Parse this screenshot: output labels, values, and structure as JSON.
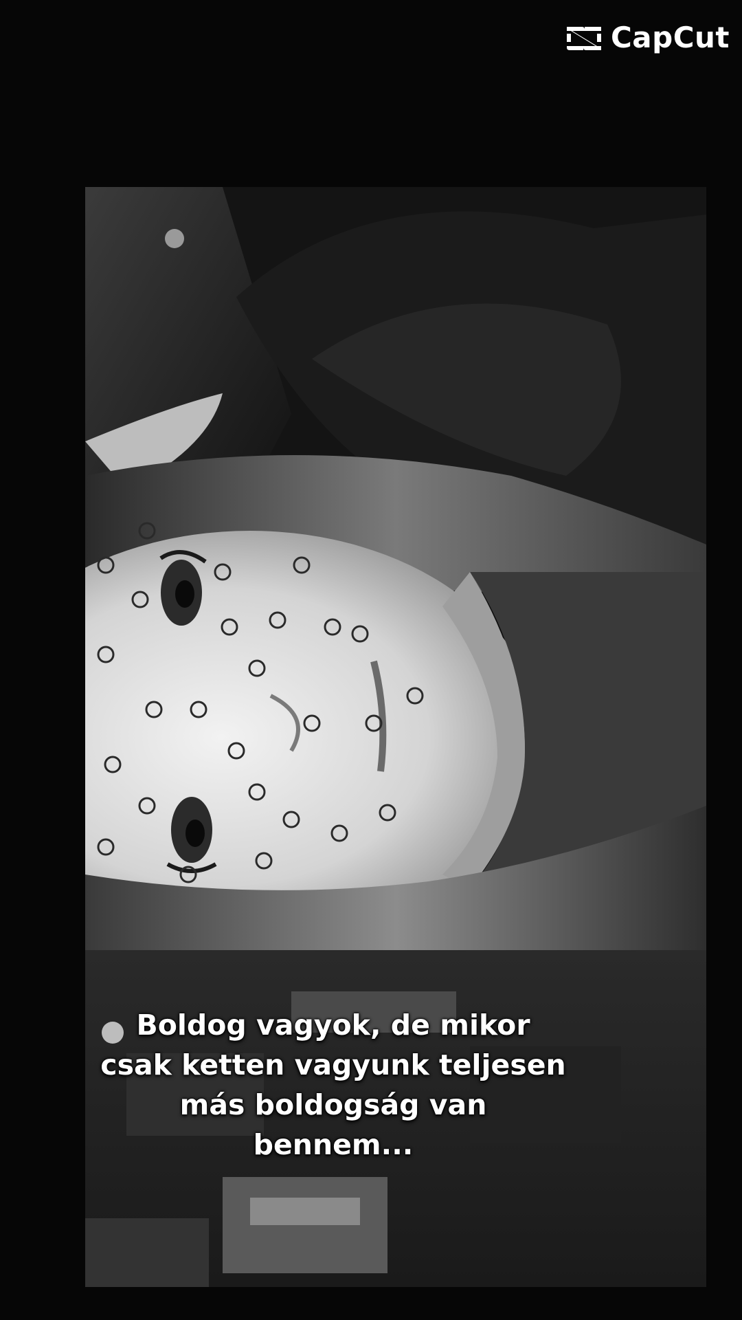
{
  "watermark": {
    "brand": "CapCut",
    "icon": "capcut-logo-icon"
  },
  "video": {
    "description_colors": {
      "background": "#060606",
      "frame": "#0d0d0d",
      "skin": "#d9d9d9",
      "hair": "#6f6f6f"
    }
  },
  "caption": {
    "lines": [
      "Boldog vagyok, de mikor",
      "csak ketten vagyunk teljesen",
      "más boldogság van",
      "bennem..."
    ]
  }
}
